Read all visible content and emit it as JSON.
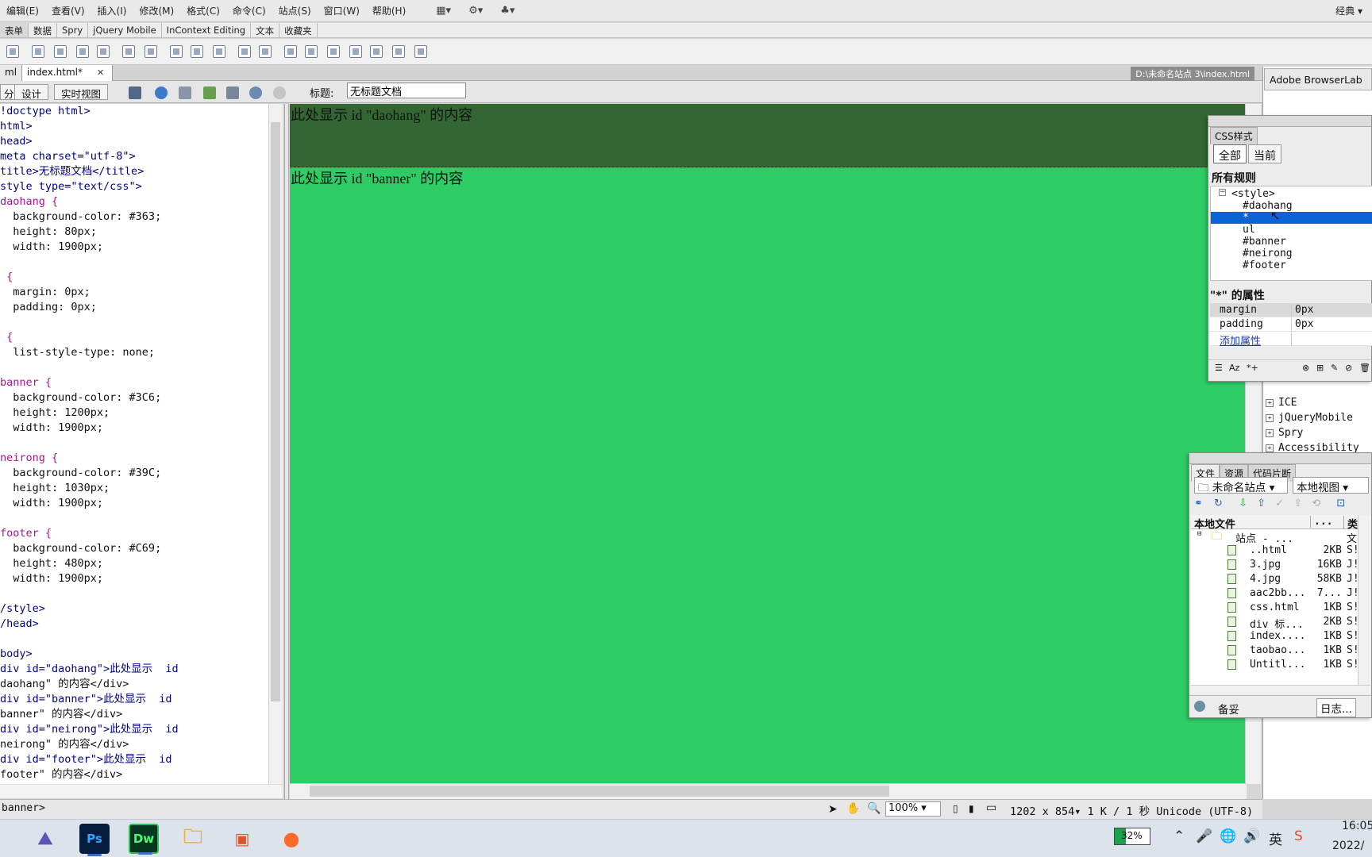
{
  "menubar": {
    "items": [
      "编辑(E)",
      "查看(V)",
      "插入(I)",
      "修改(M)",
      "格式(C)",
      "命令(C)",
      "站点(S)",
      "窗口(W)",
      "帮助(H)"
    ],
    "workspace": "经典"
  },
  "insert_tabs": [
    "表单",
    "数据",
    "Spry",
    "jQuery Mobile",
    "InContext Editing",
    "文本",
    "收藏夹"
  ],
  "doc_tabs": [
    {
      "label": "ml",
      "active": false
    },
    {
      "label": "index.html*",
      "active": true
    }
  ],
  "doc_path": "D:\\未命名站点 3\\index.html",
  "doc_toolbar": {
    "split_label": "分",
    "design_label": "设计",
    "live_view_label": "实时视图",
    "title_label": "标题:",
    "title_value": "无标题文档"
  },
  "code_lines": [
    "!doctype html>",
    "html>",
    "head>",
    "meta charset=\"utf-8\">",
    "title>无标题文档</title>",
    "style type=\"text/css\">",
    "daohang {",
    "  background-color: #363;",
    "  height: 80px;",
    "  width: 1900px;",
    "",
    " {",
    "  margin: 0px;",
    "  padding: 0px;",
    "",
    " {",
    "  list-style-type: none;",
    "",
    "banner {",
    "  background-color: #3C6;",
    "  height: 1200px;",
    "  width: 1900px;",
    "",
    "neirong {",
    "  background-color: #39C;",
    "  height: 1030px;",
    "  width: 1900px;",
    "",
    "footer {",
    "  background-color: #C69;",
    "  height: 480px;",
    "  width: 1900px;",
    "",
    "/style>",
    "/head>",
    "",
    "body>",
    "div id=\"daohang\">此处显示  id",
    "daohang\" 的内容</div>",
    "div id=\"banner\">此处显示  id",
    "banner\" 的内容</div>",
    "div id=\"neirong\">此处显示  id",
    "neirong\" 的内容</div>",
    "div id=\"footer\">此处显示  id",
    "footer\" 的内容</div>"
  ],
  "design_view": {
    "daohang_text": "此处显示 id \"daohang\" 的内容",
    "banner_text": "此处显示 id \"banner\" 的内容",
    "colors": {
      "daohang": "#336633",
      "banner": "#2ECC65"
    }
  },
  "status": {
    "tag_selector": "banner>",
    "zoom": "100%",
    "dimensions": "1202 x 854",
    "size_info": "1 K / 1 秒 Unicode (UTF-8)"
  },
  "right_panel": {
    "browserlab": "Adobe BrowserLab",
    "behind_items": [
      "ICE",
      "jQueryMobile",
      "Spry",
      "Accessibility"
    ]
  },
  "css_panel": {
    "tab": "CSS样式",
    "seg_all": "全部",
    "seg_current": "当前",
    "rules_header": "所有规则",
    "style_root": "<style>",
    "rules": [
      "#daohang",
      "*",
      "ul",
      "#banner",
      "#neirong",
      "#footer"
    ],
    "selected_rule": "*",
    "props_header": "\"*\" 的属性",
    "props": [
      {
        "key": "margin",
        "value": "0px"
      },
      {
        "key": "padding",
        "value": "0px"
      }
    ],
    "add_prop": "添加属性"
  },
  "files_panel": {
    "tabs": [
      "文件",
      "资源",
      "代码片断"
    ],
    "site": "未命名站点",
    "view": "本地视图",
    "header_local": "本地文件",
    "header_size": "...",
    "header_type": "类",
    "root": "站点 - ...",
    "root_type": "文",
    "files": [
      {
        "name": "..html",
        "size": "2KB",
        "type": "S!"
      },
      {
        "name": "3.jpg",
        "size": "16KB",
        "type": "J!"
      },
      {
        "name": "4.jpg",
        "size": "58KB",
        "type": "J!"
      },
      {
        "name": "aac2bb...",
        "size": "7...",
        "type": "J!"
      },
      {
        "name": "css.html",
        "size": "1KB",
        "type": "S!"
      },
      {
        "name": "div 标...",
        "size": "2KB",
        "type": "S!"
      },
      {
        "name": "index....",
        "size": "1KB",
        "type": "S!"
      },
      {
        "name": "taobao...",
        "size": "1KB",
        "type": "S!"
      },
      {
        "name": "Untitl...",
        "size": "1KB",
        "type": "S!"
      }
    ],
    "footer_ready": "备妥",
    "footer_log": "日志..."
  },
  "taskbar": {
    "battery": "32%",
    "ime": "英",
    "time": "16:05",
    "date": "2022/"
  }
}
